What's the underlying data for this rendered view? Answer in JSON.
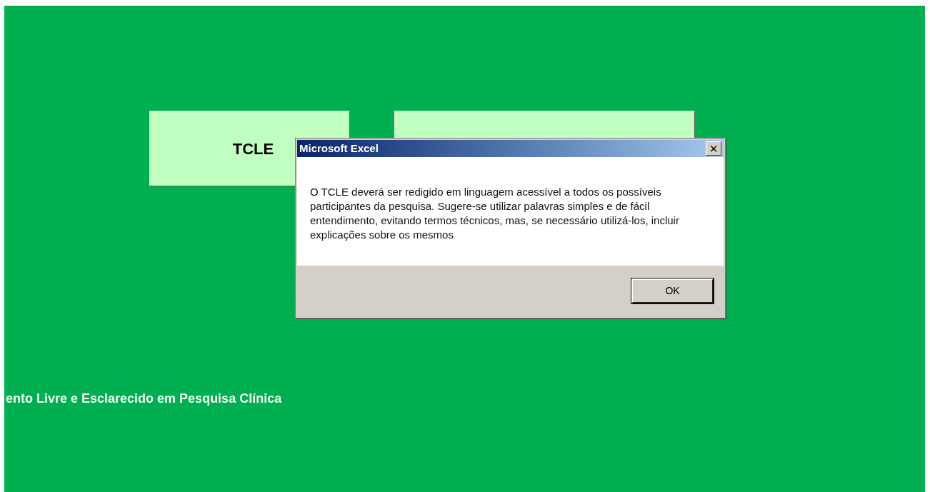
{
  "sheet": {
    "buttons": [
      {
        "label": "TCLE"
      }
    ],
    "caption": "ento Livre e Esclarecido em Pesquisa Clínica"
  },
  "dialog": {
    "title": "Microsoft Excel",
    "close": "×",
    "message": "O TCLE deverá ser redigido em linguagem acessível a todos os possíveis participantes da pesquisa. Sugere-se utilizar palavras simples e de fácil entendimento, evitando termos técnicos, mas, se necessário utilizá-los, incluir explicações sobre os mesmos",
    "buttons": [
      "OK"
    ]
  }
}
